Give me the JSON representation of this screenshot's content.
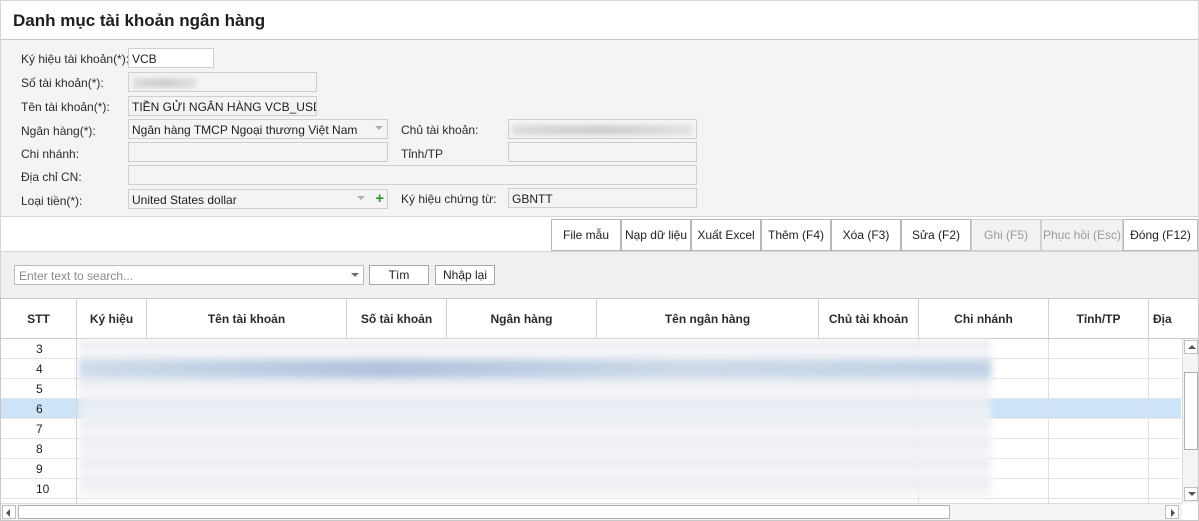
{
  "window": {
    "title": "Danh mục tài khoản ngân hàng"
  },
  "form": {
    "ky_hieu_tk": {
      "label": "Ký hiệu tài khoản(*):",
      "value": "VCB"
    },
    "so_tk": {
      "label": "Số tài khoản(*):",
      "value": ""
    },
    "ten_tk": {
      "label": "Tên tài khoản(*):",
      "value": "TIỀN GỬI NGÂN HÀNG VCB_USD"
    },
    "ngan_hang": {
      "label": "Ngân hàng(*):",
      "value": "Ngân hàng TMCP Ngoại thương Việt Nam"
    },
    "chu_tk": {
      "label": "Chủ tài khoản:",
      "value": ""
    },
    "chi_nhanh": {
      "label": "Chi nhánh:",
      "value": ""
    },
    "tinh_tp": {
      "label": "Tỉnh/TP",
      "value": ""
    },
    "dia_chi_cn": {
      "label": "Địa chỉ CN:",
      "value": ""
    },
    "loai_tien": {
      "label": "Loại tiền(*):",
      "value": "United States dollar"
    },
    "ky_hieu_ct": {
      "label": "Ký hiệu chứng từ:",
      "value": "GBNTT"
    }
  },
  "toolbar": {
    "file_mau": "File mẫu",
    "nap_du_lieu": "Nạp dữ liệu",
    "xuat_excel": "Xuất Excel",
    "them": "Thêm  (F4)",
    "xoa": "Xóa  (F3)",
    "sua": "Sửa  (F2)",
    "ghi": "Ghi  (F5)",
    "phuc_hoi": "Phục hồi  (Esc)",
    "dong": "Đóng  (F12)"
  },
  "search": {
    "placeholder": "Enter text to search...",
    "find_label": "Tìm",
    "reset_label": "Nhập lại"
  },
  "grid": {
    "columns": [
      "STT",
      "Ký hiệu",
      "Tên tài khoản",
      "Số tài khoản",
      "Ngân hàng",
      "Tên ngân hàng",
      "Chủ tài khoản",
      "Chi nhánh",
      "Tỉnh/TP",
      "Địa"
    ],
    "rows": [
      {
        "stt": "3"
      },
      {
        "stt": "4"
      },
      {
        "stt": "5"
      },
      {
        "stt": "6",
        "selected": true
      },
      {
        "stt": "7"
      },
      {
        "stt": "8"
      },
      {
        "stt": "9"
      },
      {
        "stt": "10"
      }
    ]
  },
  "colors": {
    "selected_row": "#cde3f7",
    "add_icon": "#2c9a2c"
  }
}
